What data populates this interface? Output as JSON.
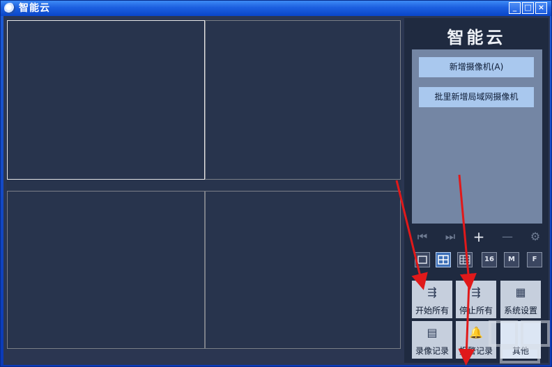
{
  "window": {
    "title": "智能云"
  },
  "titlebar": {
    "min": "_",
    "max": "□",
    "close": "×"
  },
  "panel": {
    "brand": "智能云",
    "list_buttons": [
      "新增摄像机(A)",
      "批里新增局域网摄像机"
    ]
  },
  "ptz": [
    "⏮",
    "⏭",
    "+",
    "—",
    "⚙"
  ],
  "layouts": [
    {
      "icon": "single-view-icon",
      "label": ""
    },
    {
      "icon": "quad-view-icon",
      "label": ""
    },
    {
      "icon": "nine-view-icon",
      "label": ""
    },
    {
      "icon": "sixteen-view-icon",
      "label": "16"
    },
    {
      "icon": "multi-view-icon",
      "label": "M"
    },
    {
      "icon": "fullscreen-icon",
      "label": "F"
    }
  ],
  "tiles": [
    {
      "icon": "start-all-icon",
      "label": "开始所有"
    },
    {
      "icon": "stop-all-icon",
      "label": "停止所有"
    },
    {
      "icon": "system-settings-icon",
      "label": "系统设置"
    },
    {
      "icon": "recording-icon",
      "label": "录像记录"
    },
    {
      "icon": "alarm-bell-icon",
      "label": "报警记录"
    },
    {
      "icon": "other-icon",
      "label": "其他"
    }
  ],
  "colors": {
    "accent": "#1c5fe0",
    "panel_bg": "#1f2a40",
    "arrow": "#e0191a"
  }
}
